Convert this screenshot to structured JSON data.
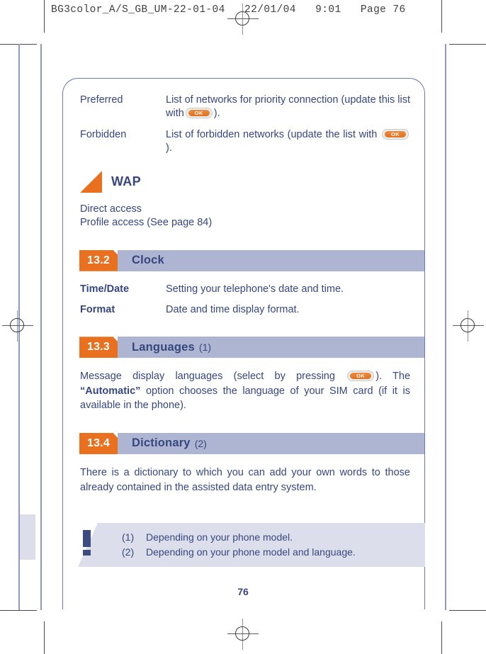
{
  "print_header": {
    "text": "BG3color_A/S_GB_UM-22-01-04   22/01/04   9:01   Page 76"
  },
  "definitions": [
    {
      "term": "Preferred",
      "desc_before": "List of networks for priority connection (update this list with",
      "key": "OK",
      "desc_after": ")."
    },
    {
      "term": "Forbidden",
      "desc_before": "List of forbidden networks (update the list with",
      "key": "OK",
      "desc_after": ")."
    }
  ],
  "wap": {
    "label": "WAP",
    "lines": [
      "Direct access",
      "Profile access (See page 84)"
    ]
  },
  "sections": [
    {
      "number": "13.2",
      "title": "Clock",
      "note": "",
      "rows": [
        {
          "term": "Time/Date",
          "desc": "Setting your telephone's date and time."
        },
        {
          "term": "Format",
          "desc": "Date and time display format."
        }
      ]
    },
    {
      "number": "13.3",
      "title": "Languages",
      "note": "(1)",
      "paragraph_1": "Message display languages (select by pressing",
      "key": "OK",
      "paragraph_2": ").  The",
      "paragraph_bold": "“Automatic”",
      "paragraph_3": " option chooses the language of your SIM card (if it is available in the phone)."
    },
    {
      "number": "13.4",
      "title": "Dictionary",
      "note": "(2)",
      "paragraph": "There is a dictionary to which you can add your own words to those already contained in the assisted data entry system."
    }
  ],
  "footnotes": [
    {
      "marker": "(1)",
      "text": "Depending on your phone model."
    },
    {
      "marker": "(2)",
      "text": "Depending on your phone model and language."
    }
  ],
  "page_number": "76",
  "colors": {
    "accent_orange": "#e8701e",
    "text_blue": "#37477e",
    "bar_blue": "#adb5d2",
    "panel_lavender": "#dcdfeb"
  }
}
